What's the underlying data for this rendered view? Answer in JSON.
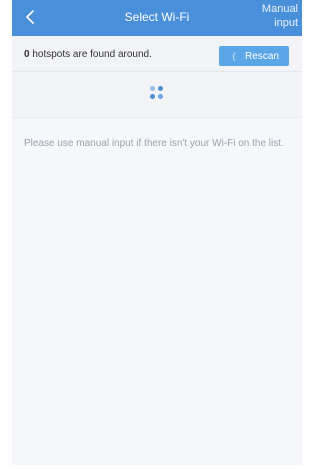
{
  "header": {
    "title": "Select Wi-Fi",
    "back_icon": "chevron-left-icon",
    "manual_input_label": "Manual input"
  },
  "hotspots": {
    "count": "0",
    "status_suffix": "hotspots are found around.",
    "rescan_label": "Rescan",
    "rescan_icon": "refresh-icon",
    "loading_icon": "spinner-icon"
  },
  "hint": {
    "text": "Please use manual input if there isn't your Wi-Fi on the list."
  },
  "colors": {
    "header_background": "#4a8fd9",
    "rescan_button": "#5ba6e6",
    "page_background": "#f5f7fa",
    "hint_text": "#9aa3ad"
  }
}
